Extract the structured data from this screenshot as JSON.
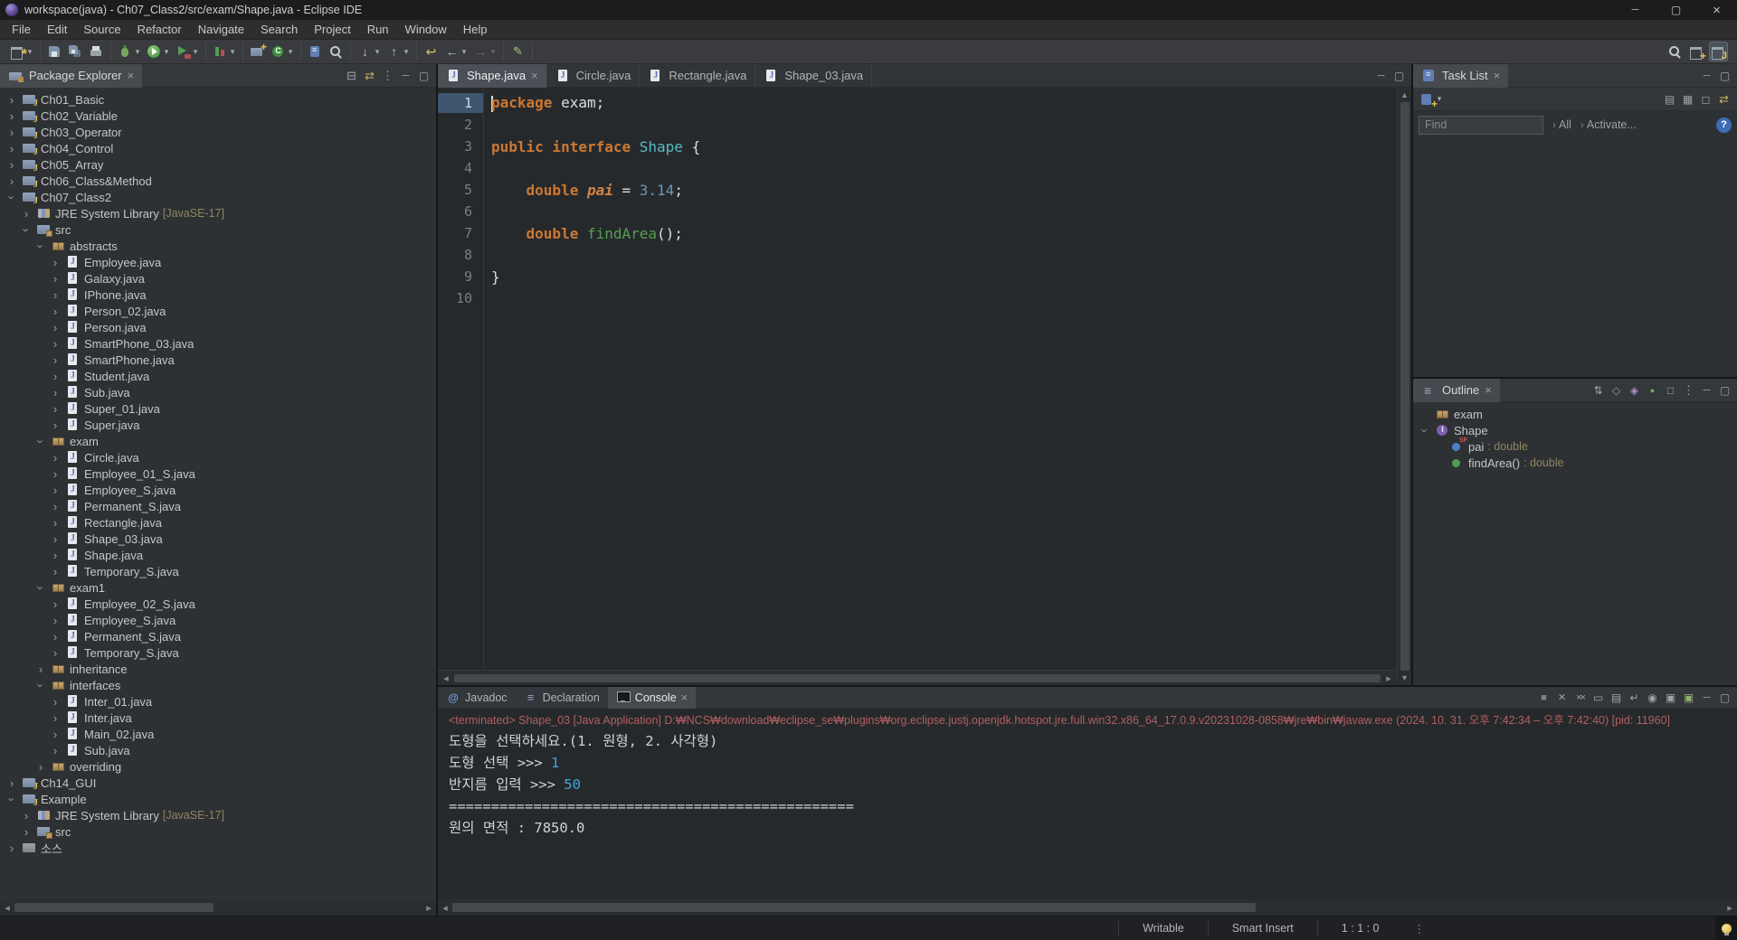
{
  "window": {
    "title": "workspace(java) - Ch07_Class2/src/exam/Shape.java - Eclipse IDE",
    "controls": [
      "minimize-icon",
      "maximize-icon",
      "close-icon"
    ]
  },
  "menubar": [
    "File",
    "Edit",
    "Source",
    "Refactor",
    "Navigate",
    "Search",
    "Project",
    "Run",
    "Window",
    "Help"
  ],
  "toolbar": {
    "groups": [
      [
        {
          "name": "new-wizard-button",
          "icon": "new-wizard-icon",
          "dropdown": true
        }
      ],
      [
        {
          "name": "save-button",
          "icon": "save-icon"
        },
        {
          "name": "save-all-button",
          "icon": "save-all-icon"
        },
        {
          "name": "print-button",
          "icon": "print-icon"
        }
      ],
      [
        {
          "name": "debug-button",
          "icon": "debug-icon",
          "dropdown": true
        },
        {
          "name": "run-button",
          "icon": "run-icon",
          "dropdown": true
        },
        {
          "name": "run-external-tools-button",
          "icon": "external-tools-icon",
          "dropdown": true
        }
      ],
      [
        {
          "name": "coverage-button",
          "icon": "coverage-icon",
          "dropdown": true
        }
      ],
      [
        {
          "name": "new-java-project-button",
          "icon": "new-java-project-icon"
        },
        {
          "name": "new-class-button",
          "icon": "new-class-icon",
          "dropdown": true
        }
      ],
      [
        {
          "name": "open-task-button",
          "icon": "open-task-icon"
        },
        {
          "name": "search-button",
          "icon": "search-flashlight-icon"
        }
      ],
      [
        {
          "name": "next-annotation-button",
          "icon": "next-annotation-icon",
          "dropdown": true
        },
        {
          "name": "previous-annotation-button",
          "icon": "prev-annotation-icon",
          "dropdown": true
        }
      ],
      [
        {
          "name": "last-edit-location-button",
          "icon": "last-edit-icon"
        },
        {
          "name": "back-button",
          "icon": "back-icon",
          "dropdown": true
        },
        {
          "name": "forward-button",
          "icon": "forward-icon",
          "dropdown": true,
          "state": "disabled"
        }
      ],
      [
        {
          "name": "pin-editor-button",
          "icon": "pin-editor-icon"
        }
      ]
    ],
    "right": [
      {
        "name": "quick-search-button",
        "icon": "magnifier-icon"
      },
      {
        "name": "open-perspective-button",
        "icon": "open-perspective-icon"
      },
      {
        "name": "java-perspective-button",
        "icon": "java-perspective-icon",
        "state": "active"
      }
    ]
  },
  "package_explorer": {
    "title": "Package Explorer",
    "header_icons": [
      "collapse-all-icon",
      "link-with-editor-icon",
      "view-menu-icon",
      "minimize-icon",
      "maximize-icon"
    ],
    "tree": [
      {
        "depth": 0,
        "exp": "closed",
        "icon": "java-project-icon",
        "label": "Ch01_Basic"
      },
      {
        "depth": 0,
        "exp": "closed",
        "icon": "java-project-icon",
        "label": "Ch02_Variable"
      },
      {
        "depth": 0,
        "exp": "closed",
        "icon": "java-project-icon",
        "label": "Ch03_Operator"
      },
      {
        "depth": 0,
        "exp": "closed",
        "icon": "java-project-icon",
        "label": "Ch04_Control"
      },
      {
        "depth": 0,
        "exp": "closed",
        "icon": "java-project-icon",
        "label": "Ch05_Array"
      },
      {
        "depth": 0,
        "exp": "closed",
        "icon": "java-project-icon",
        "label": "Ch06_Class&Method"
      },
      {
        "depth": 0,
        "exp": "open",
        "icon": "java-project-icon",
        "label": "Ch07_Class2"
      },
      {
        "depth": 1,
        "exp": "closed",
        "icon": "library-icon",
        "label": "JRE System Library",
        "decorator": "[JavaSE-17]"
      },
      {
        "depth": 1,
        "exp": "open",
        "icon": "src-folder-icon",
        "label": "src"
      },
      {
        "depth": 2,
        "exp": "open",
        "icon": "package-icon",
        "label": "abstracts"
      },
      {
        "depth": 3,
        "exp": "closed",
        "icon": "java-file-icon",
        "label": "Employee.java"
      },
      {
        "depth": 3,
        "exp": "closed",
        "icon": "java-file-icon",
        "label": "Galaxy.java"
      },
      {
        "depth": 3,
        "exp": "closed",
        "icon": "java-file-icon",
        "label": "IPhone.java"
      },
      {
        "depth": 3,
        "exp": "closed",
        "icon": "java-file-icon",
        "label": "Person_02.java"
      },
      {
        "depth": 3,
        "exp": "closed",
        "icon": "java-file-icon",
        "label": "Person.java"
      },
      {
        "depth": 3,
        "exp": "closed",
        "icon": "java-file-icon",
        "label": "SmartPhone_03.java"
      },
      {
        "depth": 3,
        "exp": "closed",
        "icon": "java-file-icon",
        "label": "SmartPhone.java"
      },
      {
        "depth": 3,
        "exp": "closed",
        "icon": "java-file-icon",
        "label": "Student.java"
      },
      {
        "depth": 3,
        "exp": "closed",
        "icon": "java-file-icon",
        "label": "Sub.java"
      },
      {
        "depth": 3,
        "exp": "closed",
        "icon": "java-file-icon",
        "label": "Super_01.java"
      },
      {
        "depth": 3,
        "exp": "closed",
        "icon": "java-file-icon",
        "label": "Super.java"
      },
      {
        "depth": 2,
        "exp": "open",
        "icon": "package-icon",
        "label": "exam"
      },
      {
        "depth": 3,
        "exp": "closed",
        "icon": "java-file-icon",
        "label": "Circle.java"
      },
      {
        "depth": 3,
        "exp": "closed",
        "icon": "java-file-icon",
        "label": "Employee_01_S.java"
      },
      {
        "depth": 3,
        "exp": "closed",
        "icon": "java-file-icon",
        "label": "Employee_S.java"
      },
      {
        "depth": 3,
        "exp": "closed",
        "icon": "java-file-icon",
        "label": "Permanent_S.java"
      },
      {
        "depth": 3,
        "exp": "closed",
        "icon": "java-file-icon",
        "label": "Rectangle.java"
      },
      {
        "depth": 3,
        "exp": "closed",
        "icon": "java-file-icon",
        "label": "Shape_03.java"
      },
      {
        "depth": 3,
        "exp": "closed",
        "icon": "java-file-icon",
        "label": "Shape.java"
      },
      {
        "depth": 3,
        "exp": "closed",
        "icon": "java-file-icon",
        "label": "Temporary_S.java"
      },
      {
        "depth": 2,
        "exp": "open",
        "icon": "package-icon",
        "label": "exam1"
      },
      {
        "depth": 3,
        "exp": "closed",
        "icon": "java-file-icon",
        "label": "Employee_02_S.java"
      },
      {
        "depth": 3,
        "exp": "closed",
        "icon": "java-file-icon",
        "label": "Employee_S.java"
      },
      {
        "depth": 3,
        "exp": "closed",
        "icon": "java-file-icon",
        "label": "Permanent_S.java"
      },
      {
        "depth": 3,
        "exp": "closed",
        "icon": "java-file-icon",
        "label": "Temporary_S.java"
      },
      {
        "depth": 2,
        "exp": "closed",
        "icon": "package-icon",
        "label": "inheritance"
      },
      {
        "depth": 2,
        "exp": "open",
        "icon": "package-icon",
        "label": "interfaces"
      },
      {
        "depth": 3,
        "exp": "closed",
        "icon": "java-file-icon",
        "label": "Inter_01.java"
      },
      {
        "depth": 3,
        "exp": "closed",
        "icon": "java-file-icon",
        "label": "Inter.java"
      },
      {
        "depth": 3,
        "exp": "closed",
        "icon": "java-file-icon",
        "label": "Main_02.java"
      },
      {
        "depth": 3,
        "exp": "closed",
        "icon": "java-file-icon",
        "label": "Sub.java"
      },
      {
        "depth": 2,
        "exp": "closed",
        "icon": "package-icon",
        "label": "overriding"
      },
      {
        "depth": 0,
        "exp": "closed",
        "icon": "java-project-icon",
        "label": "Ch14_GUI"
      },
      {
        "depth": 0,
        "exp": "open",
        "icon": "java-project-icon",
        "label": "Example"
      },
      {
        "depth": 1,
        "exp": "closed",
        "icon": "library-icon",
        "label": "JRE System Library",
        "decorator": "[JavaSE-17]"
      },
      {
        "depth": 1,
        "exp": "closed",
        "icon": "src-folder-icon",
        "label": "src"
      },
      {
        "depth": 0,
        "exp": "closed",
        "icon": "general-project-icon",
        "label": "소스"
      }
    ]
  },
  "editor": {
    "tabs": [
      {
        "name": "editor-tab-shape-java",
        "label": "Shape.java",
        "icon": "java-file-icon",
        "state": "active",
        "closable": true
      },
      {
        "name": "editor-tab-circle-java",
        "label": "Circle.java",
        "icon": "java-file-icon"
      },
      {
        "name": "editor-tab-rectangle-java",
        "label": "Rectangle.java",
        "icon": "java-file-icon"
      },
      {
        "name": "editor-tab-shape03-java",
        "label": "Shape_03.java",
        "icon": "java-file-icon"
      }
    ],
    "tabbar_icons": [
      "minimize-icon",
      "maximize-icon"
    ],
    "lines": [
      {
        "n": 1,
        "sel": "sel",
        "tokens": [
          {
            "t": "",
            "c": "cursor"
          },
          {
            "t": "package",
            "c": "kw"
          },
          {
            "t": " exam;",
            "c": "pl"
          }
        ]
      },
      {
        "n": 2,
        "tokens": []
      },
      {
        "n": 3,
        "tokens": [
          {
            "t": "public interface",
            "c": "kw"
          },
          {
            "t": " ",
            "c": "pl"
          },
          {
            "t": "Shape",
            "c": "type"
          },
          {
            "t": " {",
            "c": "pl"
          }
        ]
      },
      {
        "n": 4,
        "tokens": []
      },
      {
        "n": 5,
        "tokens": [
          {
            "t": "    ",
            "c": "pl"
          },
          {
            "t": "double",
            "c": "kw"
          },
          {
            "t": " ",
            "c": "pl"
          },
          {
            "t": "pai",
            "c": "const"
          },
          {
            "t": " = ",
            "c": "pl"
          },
          {
            "t": "3.14",
            "c": "num"
          },
          {
            "t": ";",
            "c": "pl"
          }
        ]
      },
      {
        "n": 6,
        "tokens": []
      },
      {
        "n": 7,
        "tokens": [
          {
            "t": "    ",
            "c": "pl"
          },
          {
            "t": "double",
            "c": "kw"
          },
          {
            "t": " ",
            "c": "pl"
          },
          {
            "t": "findArea",
            "c": "method"
          },
          {
            "t": "();",
            "c": "pl"
          }
        ]
      },
      {
        "n": 8,
        "tokens": []
      },
      {
        "n": 9,
        "tokens": [
          {
            "t": "}",
            "c": "pl"
          }
        ]
      },
      {
        "n": 10,
        "tokens": []
      }
    ]
  },
  "task_list": {
    "title": "Task List",
    "header_icons": [
      "minimize-icon",
      "maximize-icon"
    ],
    "toolbar_left": [
      {
        "name": "new-task-button",
        "icon": "new-task-icon",
        "dropdown": true
      }
    ],
    "toolbar_icons": [
      "categorized-icon",
      "scheduled-icon",
      "filter-completed-icon",
      "link-with-editor-icon"
    ],
    "find_placeholder": "Find",
    "all_label": "All",
    "activate_label": "Activate..."
  },
  "outline": {
    "title": "Outline",
    "header_icons": [
      "sort-icon",
      "hide-fields-icon",
      "hide-static-icon",
      "hide-non-public-icon",
      "hide-local-types-icon",
      "view-menu-icon",
      "minimize-icon",
      "maximize-icon"
    ],
    "items": [
      {
        "depth": 0,
        "exp": "none",
        "icon": "package-icon",
        "label": "exam"
      },
      {
        "depth": 0,
        "exp": "open",
        "icon": "interface-icon",
        "label": "Shape"
      },
      {
        "depth": 1,
        "exp": "none",
        "icon": "field-const-icon",
        "label": "pai",
        "decorator": " : double"
      },
      {
        "depth": 1,
        "exp": "none",
        "icon": "method-icon",
        "label": "findArea()",
        "decorator": " : double"
      }
    ]
  },
  "console": {
    "tabs": [
      {
        "name": "javadoc-tab",
        "label": "Javadoc",
        "icon": "javadoc-icon"
      },
      {
        "name": "declaration-tab",
        "label": "Declaration",
        "icon": "declaration-icon"
      },
      {
        "name": "console-tab",
        "label": "Console",
        "icon": "console-icon",
        "state": "active",
        "closable": true
      }
    ],
    "header_icons": [
      "terminate-icon",
      "remove-launch-icon",
      "remove-all-launches-icon",
      "clear-console-icon",
      "scroll-lock-icon",
      "word-wrap-icon",
      "pin-console-icon",
      "display-selected-console-icon",
      "open-console-icon",
      "minimize-icon",
      "maximize-icon"
    ],
    "meta": "<terminated> Shape_03 [Java Application] D:₩NCS₩download₩eclipse_se₩plugins₩org.eclipse.justj.openjdk.hotspot.jre.full.win32.x86_64_17.0.9.v20231028-0858₩jre₩bin₩javaw.exe (2024. 10. 31. 오후 7:42:34 – 오후 7:42:40) [pid: 11960]",
    "lines": [
      {
        "spans": [
          {
            "t": "도형을 선택하세요.(1. 원형, 2. 사각형)",
            "c": "out"
          }
        ]
      },
      {
        "spans": [
          {
            "t": "도형 선택 >>> ",
            "c": "out"
          },
          {
            "t": "1",
            "c": "in"
          }
        ]
      },
      {
        "spans": [
          {
            "t": "반지름 입력 >>> ",
            "c": "out"
          },
          {
            "t": "50",
            "c": "in"
          }
        ]
      },
      {
        "spans": [
          {
            "t": "================================================",
            "c": "out"
          }
        ]
      },
      {
        "spans": [
          {
            "t": "원의 면적 : 7850.0",
            "c": "out"
          }
        ]
      }
    ]
  },
  "status_bar": {
    "writable": "Writable",
    "input_mode": "Smart Insert",
    "cursor_position": "1 : 1 : 0"
  },
  "colors": {
    "editor_background": "#26292C",
    "keyword": "#CC7832",
    "type_name": "#59B9C4",
    "constant": "#D28445",
    "number": "#6897BB",
    "method_declaration": "#55A04E",
    "console_stdout": "#CFD2D6",
    "console_stdin": "#40A6D4",
    "console_process_info": "#B25F5F",
    "current_line_number_highlight": "#3E566E",
    "decorator_text": "#8F8563"
  }
}
